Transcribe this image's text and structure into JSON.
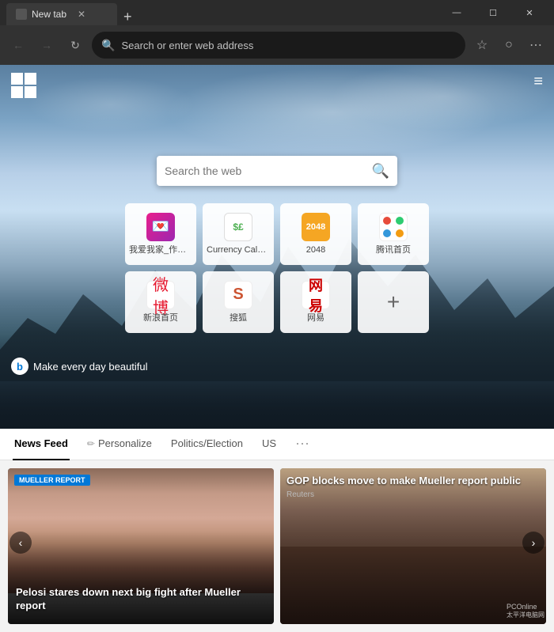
{
  "titlebar": {
    "tab_title": "New tab",
    "new_tab_label": "+",
    "minimize_label": "—",
    "maximize_label": "☐",
    "close_label": "✕"
  },
  "addressbar": {
    "back_icon": "←",
    "forward_icon": "→",
    "refresh_icon": "↻",
    "placeholder": "Search or enter web address",
    "star_icon": "☆",
    "profile_icon": "○",
    "more_icon": "⋯"
  },
  "hero": {
    "search_placeholder": "Search the web",
    "bing_tagline": "Make every day beautiful",
    "menu_icon": "≡"
  },
  "quicklinks": [
    {
      "id": "woai",
      "label": "我爱我家_作者…",
      "icon": "📱"
    },
    {
      "id": "currency",
      "label": "Currency Calcu…",
      "icon": "$"
    },
    {
      "id": "2048",
      "label": "2048",
      "icon": "2048"
    },
    {
      "id": "tencent",
      "label": "腾讯首页",
      "icon": "🌐"
    },
    {
      "id": "weibo",
      "label": "新浪首页",
      "icon": "微"
    },
    {
      "id": "souhu",
      "label": "搜狐",
      "icon": "S"
    },
    {
      "id": "wangyi",
      "label": "网易",
      "icon": "网"
    },
    {
      "id": "add",
      "label": "",
      "icon": "+"
    }
  ],
  "news": {
    "tabs": [
      {
        "id": "feed",
        "label": "News Feed",
        "active": true
      },
      {
        "id": "personalize",
        "label": "Personalize",
        "icon": "✏"
      },
      {
        "id": "politics",
        "label": "Politics/Election",
        "active": false
      },
      {
        "id": "us",
        "label": "US",
        "active": false
      }
    ],
    "more_icon": "…",
    "cards": [
      {
        "id": "pelosi",
        "badge": "MUELLER REPORT",
        "title": "Pelosi stares down next big fight after Mueller report",
        "source": ""
      },
      {
        "id": "gop",
        "title_top": "GOP blocks move to make Mueller report public",
        "source_top": "Reuters",
        "title_bottom": "",
        "source_bottom": ""
      }
    ],
    "nav_left": "‹",
    "nav_right": "›"
  },
  "watermark": {
    "text": "PCOnline",
    "subtext": "太平洋电脑网"
  }
}
